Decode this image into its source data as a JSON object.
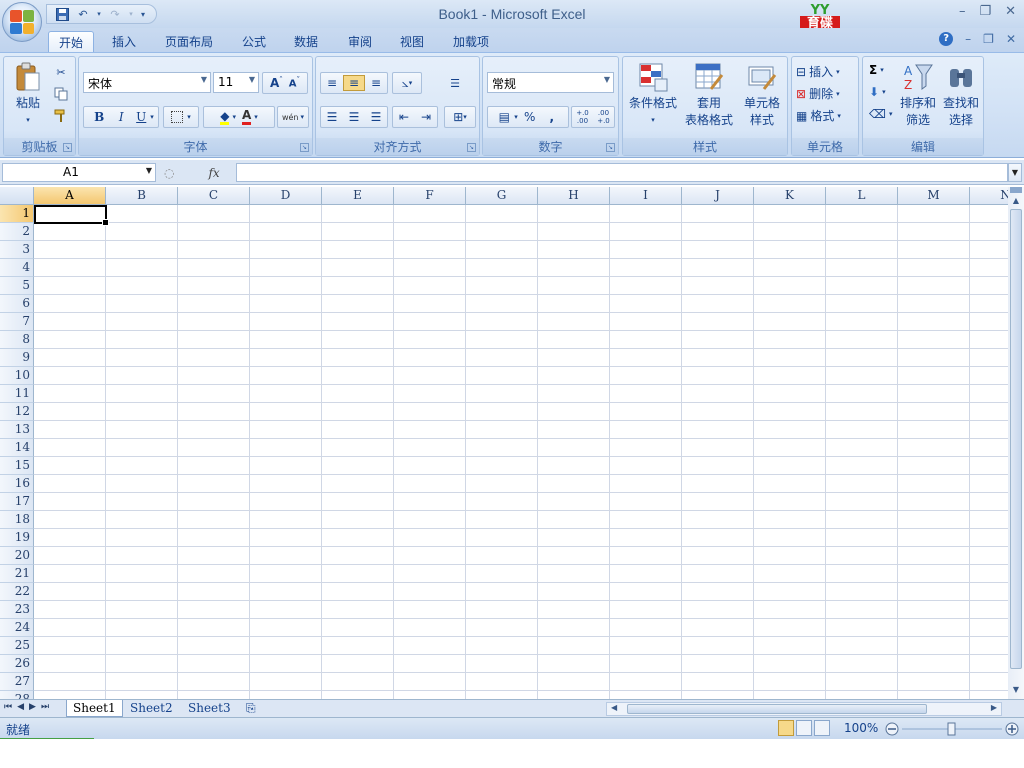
{
  "window": {
    "title": "Book1 - Microsoft Excel",
    "logo_text": [
      "育碟",
      "软件"
    ]
  },
  "ribbon_tabs": [
    {
      "label": "开始",
      "active": true
    },
    {
      "label": "插入"
    },
    {
      "label": "页面布局"
    },
    {
      "label": "公式"
    },
    {
      "label": "数据"
    },
    {
      "label": "审阅"
    },
    {
      "label": "视图"
    },
    {
      "label": "加载项"
    }
  ],
  "groups": {
    "clipboard": {
      "label": "剪贴板",
      "paste": "粘贴"
    },
    "font": {
      "label": "字体",
      "font_name": "宋体",
      "font_size": "11",
      "bold": "B",
      "italic": "I",
      "underline": "U",
      "phonetic": "wén"
    },
    "alignment": {
      "label": "对齐方式"
    },
    "number": {
      "label": "数字",
      "format": "常规",
      "percent": "%",
      "comma": ",",
      "inc_decimal": "+.0 .00",
      "dec_decimal": ".00 +.0"
    },
    "styles": {
      "label": "样式",
      "conditional": "条件格式",
      "table_fmt_1": "套用",
      "table_fmt_2": "表格格式",
      "cell_style_1": "单元格",
      "cell_style_2": "样式"
    },
    "cells": {
      "label": "单元格",
      "insert": "插入",
      "delete": "删除",
      "format": "格式"
    },
    "editing": {
      "label": "编辑",
      "sum": "Σ",
      "sort_1": "排序和",
      "sort_2": "筛选",
      "find_1": "查找和",
      "find_2": "选择"
    }
  },
  "formula_bar": {
    "name_box": "A1",
    "fx": "fx",
    "content": ""
  },
  "columns": [
    "A",
    "B",
    "C",
    "D",
    "E",
    "F",
    "G",
    "H",
    "I",
    "J",
    "K",
    "L",
    "M",
    "N"
  ],
  "rows": [
    "1",
    "2",
    "3",
    "4",
    "5",
    "6",
    "7",
    "8",
    "9",
    "10",
    "11",
    "12",
    "13",
    "14",
    "15",
    "16",
    "17",
    "18",
    "19",
    "20",
    "21",
    "22",
    "23",
    "24",
    "25",
    "26",
    "27",
    "28"
  ],
  "selected_cell": "A1",
  "sheets": [
    {
      "label": "Sheet1",
      "active": true
    },
    {
      "label": "Sheet2"
    },
    {
      "label": "Sheet3"
    }
  ],
  "status": {
    "text": "就绪",
    "zoom": "100%"
  }
}
